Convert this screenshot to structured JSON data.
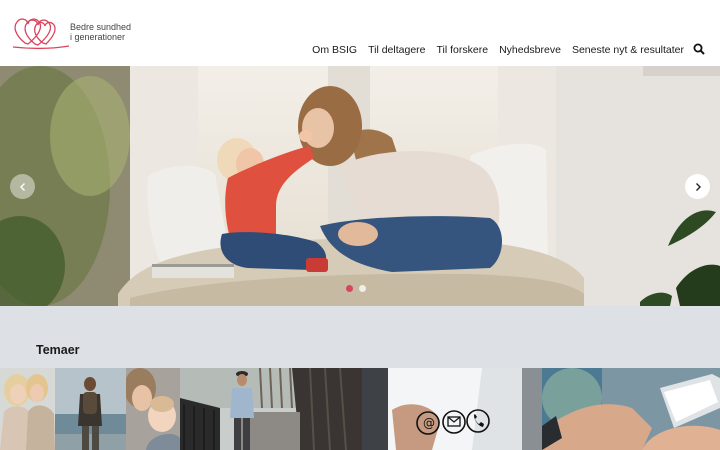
{
  "site": {
    "logo_line1": "Bedre sundhed",
    "logo_line2": "i generationer",
    "brand_color": "#d9455f"
  },
  "nav": {
    "items": [
      {
        "label": "Om BSIG"
      },
      {
        "label": "Til deltagere"
      },
      {
        "label": "Til forskere"
      },
      {
        "label": "Nyhedsbreve"
      },
      {
        "label": "Seneste nyt & resultater"
      }
    ],
    "search_icon": "search-icon"
  },
  "hero": {
    "slide_count": 2,
    "active_slide": 1,
    "prev_icon": "chevron-left-icon",
    "next_icon": "chevron-right-icon"
  },
  "themes": {
    "title": "Temaer"
  }
}
